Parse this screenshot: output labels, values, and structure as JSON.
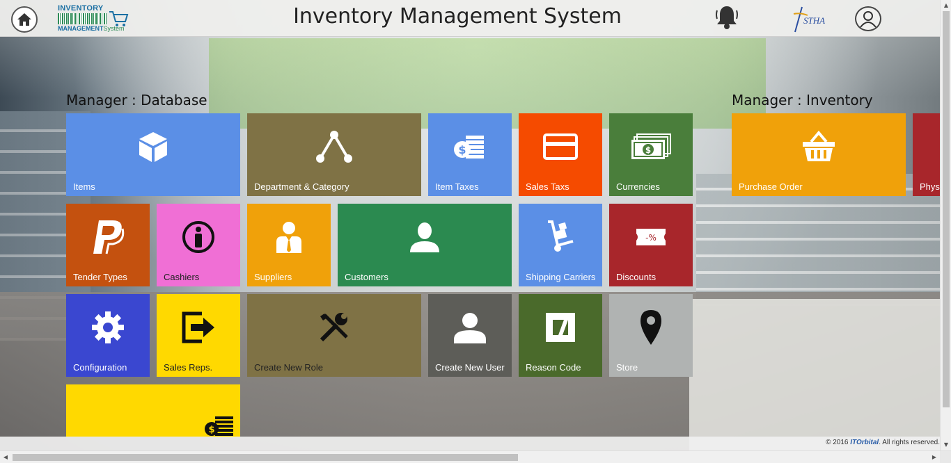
{
  "header": {
    "title": "Inventory Management System",
    "logo_line1": "INVENTORY",
    "logo_line2": "MANAGEMENT",
    "logo_line2_suffix": "System",
    "partner_logo_text": "STHA"
  },
  "sections": {
    "database": "Manager : Database",
    "inventory": "Manager : Inventory"
  },
  "tiles": {
    "items": {
      "label": "Items",
      "color": "#5b8fe6",
      "icon": "cube-icon"
    },
    "department": {
      "label": "Department & Category",
      "color": "#7f7245",
      "icon": "hierarchy-icon"
    },
    "item_taxes": {
      "label": "Item Taxes",
      "color": "#5b8fe6",
      "icon": "coins-icon"
    },
    "sales_taxs": {
      "label": "Sales Taxs",
      "color": "#f54b00",
      "icon": "credit-card-icon"
    },
    "currencies": {
      "label": "Currencies",
      "color": "#4a7e3b",
      "icon": "banknotes-icon"
    },
    "purchase_order": {
      "label": "Purchase Order",
      "color": "#f0a10a",
      "icon": "basket-icon"
    },
    "physical": {
      "label": "Phys",
      "color": "#a8262b",
      "icon": ""
    },
    "tender_types": {
      "label": "Tender Types",
      "color": "#c4510f",
      "icon": "paypal-icon"
    },
    "cashiers": {
      "label": "Cashiers",
      "color": "#f06fd5",
      "icon": "info-person-icon"
    },
    "suppliers": {
      "label": "Suppliers",
      "color": "#f0a10a",
      "icon": "businessman-icon"
    },
    "customers": {
      "label": "Customers",
      "color": "#2b8a50",
      "icon": "user-icon"
    },
    "shipping_carriers": {
      "label": "Shipping Carriers",
      "color": "#5b8fe6",
      "icon": "hand-truck-icon"
    },
    "discounts": {
      "label": "Discounts",
      "color": "#a8262b",
      "icon": "discount-ticket-icon"
    },
    "configuration": {
      "label": "Configuration",
      "color": "#3a47d0",
      "icon": "gear-icon"
    },
    "sales_reps": {
      "label": "Sales Reps.",
      "color": "#ffd900",
      "icon": "exit-arrow-icon"
    },
    "create_role": {
      "label": "Create New Role",
      "color": "#7f7245",
      "icon": "tools-icon"
    },
    "create_user": {
      "label": "Create New User",
      "color": "#5d5d58",
      "icon": "user-icon"
    },
    "reason_code": {
      "label": "Reason Code",
      "color": "#4a6a2b",
      "icon": "reason-code-icon"
    },
    "store": {
      "label": "Store",
      "color": "#b0b3b2",
      "icon": "map-pin-icon"
    },
    "extra": {
      "label": "",
      "color": "#ffd900",
      "icon": "coins-icon"
    }
  },
  "footer": {
    "copyright": "© 2016",
    "brand": "ITOrbital",
    "rights": ". All rights reserved."
  }
}
